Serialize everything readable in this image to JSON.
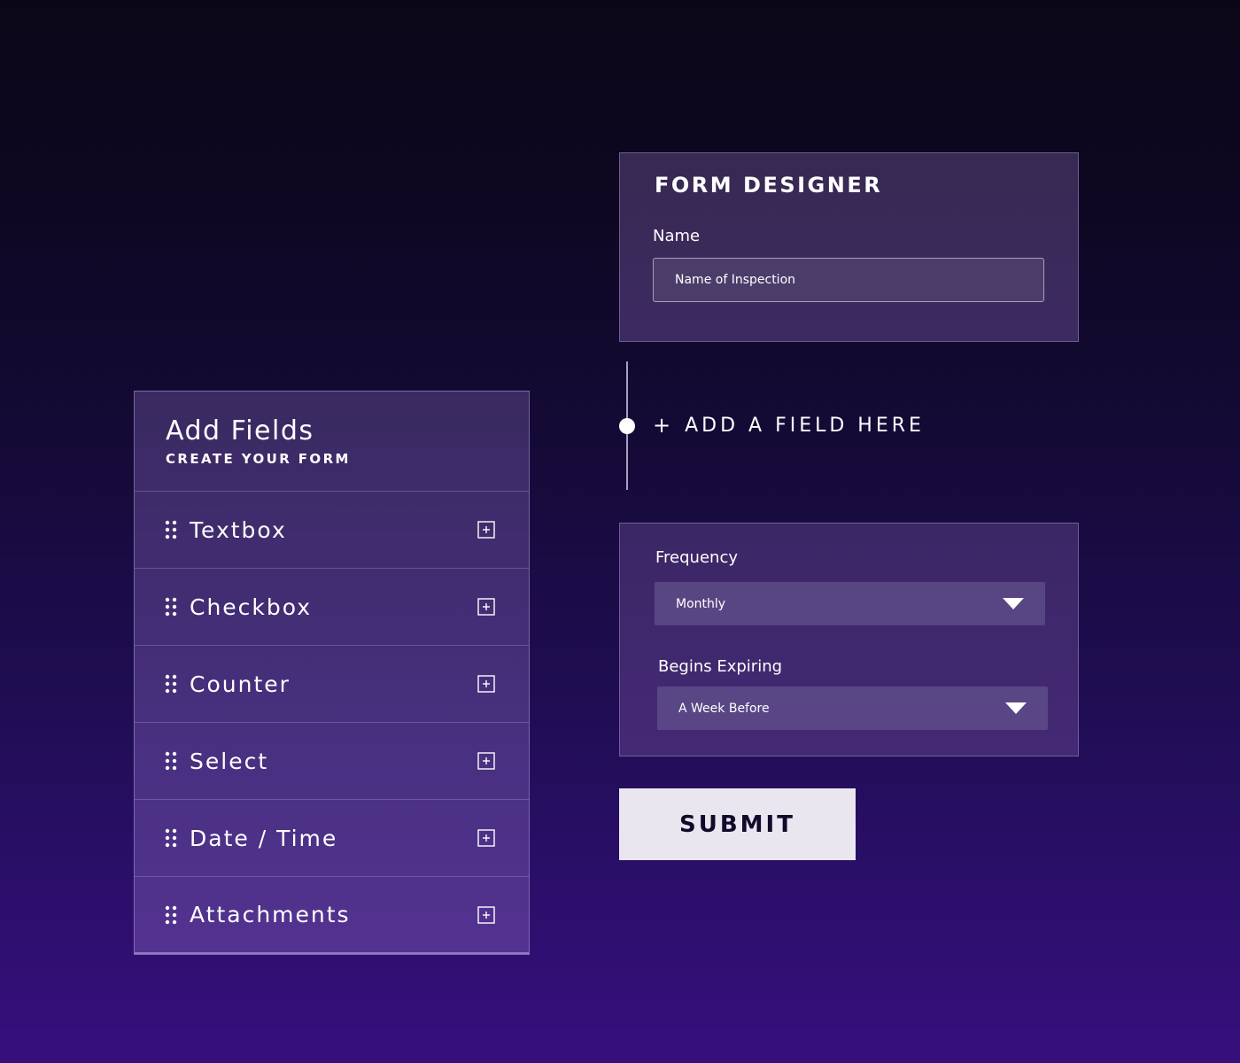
{
  "add_fields": {
    "title": "Add Fields",
    "subtitle": "CREATE YOUR FORM",
    "items": [
      {
        "label": "Textbox"
      },
      {
        "label": "Checkbox"
      },
      {
        "label": "Counter"
      },
      {
        "label": "Select"
      },
      {
        "label": "Date / Time"
      },
      {
        "label": "Attachments"
      }
    ]
  },
  "form_designer": {
    "title": "FORM DESIGNER",
    "name_label": "Name",
    "name_placeholder": "Name of Inspection"
  },
  "add_field_link": {
    "plus": "+",
    "label": "ADD A FIELD HERE"
  },
  "schedule": {
    "frequency_label": "Frequency",
    "frequency_value": "Monthly",
    "expiring_label": "Begins Expiring",
    "expiring_value": "A Week Before"
  },
  "submit": {
    "label": "SUBMIT"
  },
  "icons": {
    "drag": "drag-handle-icon",
    "add": "plus-square-icon",
    "chevron": "chevron-down-icon"
  },
  "colors": {
    "background_top": "#0b0617",
    "background_bottom": "#370f7d",
    "submit_bg": "#e9e6ef",
    "submit_text": "#120a2a"
  }
}
